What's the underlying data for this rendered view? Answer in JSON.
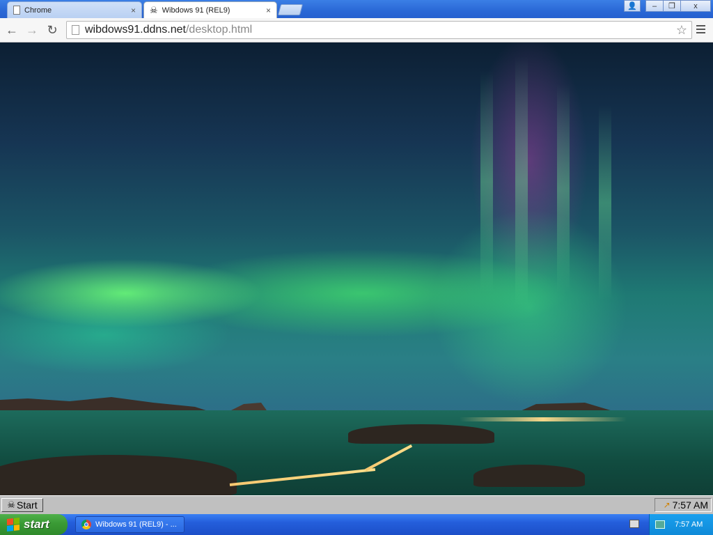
{
  "browser": {
    "tabs": [
      {
        "label": "Chrome",
        "close": "×",
        "icon": "page-icon"
      },
      {
        "label": "Wibdows 91 (REL9)",
        "close": "×",
        "icon": "wibdows-icon"
      }
    ],
    "window_buttons": {
      "user": "👤",
      "minimize": "–",
      "restore": "❐",
      "close": "x"
    },
    "nav": {
      "back": "←",
      "forward": "→",
      "reload": "↻"
    },
    "url": {
      "host": "wibdows91.ddns.net",
      "path": "/desktop.html"
    },
    "star": "☆"
  },
  "inner_os": {
    "start_label": "Start",
    "start_logo": "☠",
    "clock": "7:57 AM",
    "tray_icon": "↗"
  },
  "host_os": {
    "start_label": "start",
    "task_label": "Wibdows 91 (REL9) - ...",
    "clock": "7:57 AM",
    "colors": {
      "taskbar": "#245edb",
      "start": "#3a9a35",
      "tray": "#0f8ad8"
    }
  }
}
